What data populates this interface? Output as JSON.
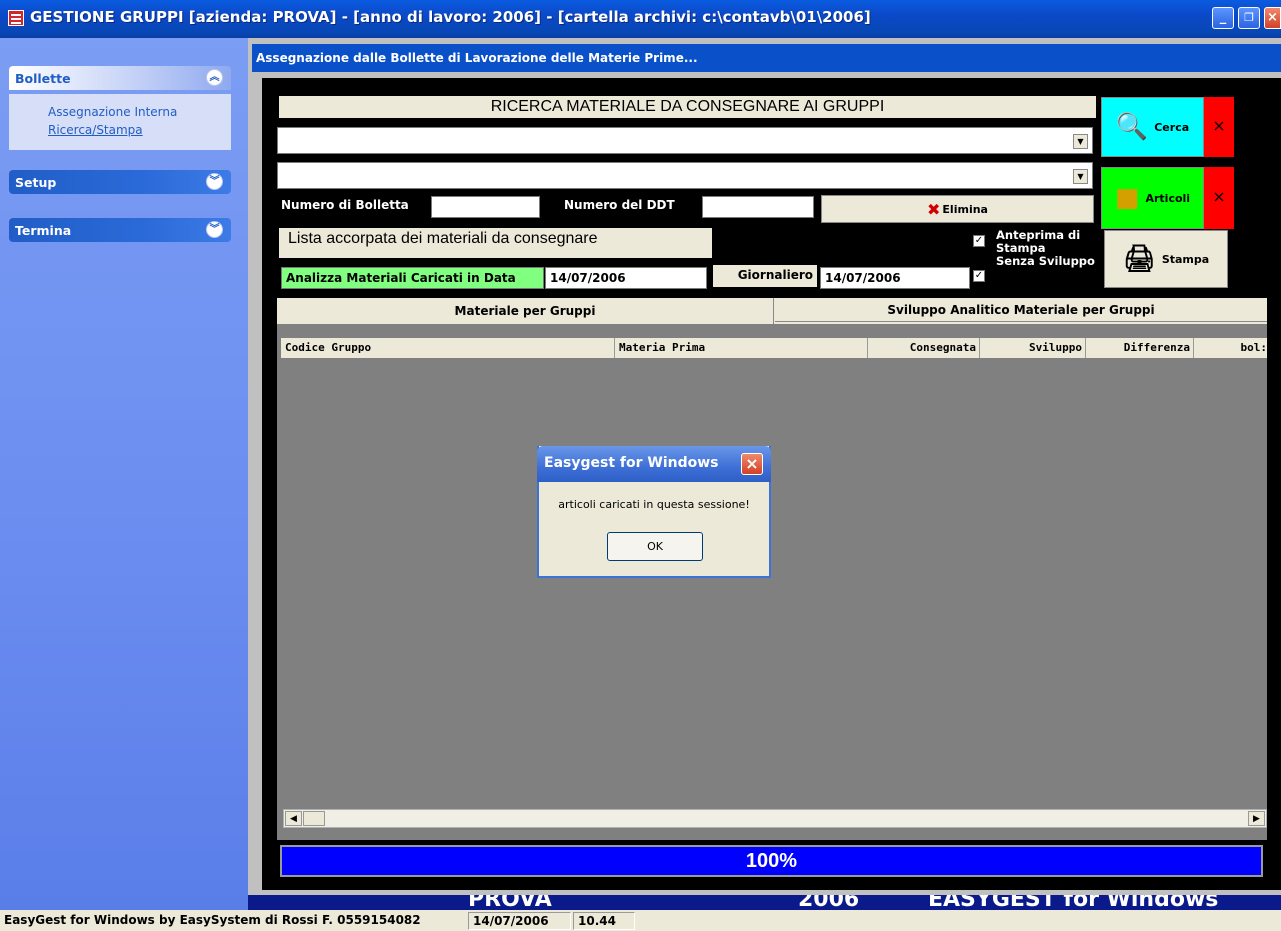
{
  "window": {
    "title": "GESTIONE GRUPPI [azienda: PROVA] - [anno di lavoro: 2006] - [cartella archivi: c:\\contavb\\01\\2006]",
    "controls": [
      "minimize",
      "restore",
      "close"
    ]
  },
  "sidebar": {
    "groups": [
      {
        "label": "Bollette",
        "expanded": true,
        "items": [
          "Assegnazione Interna",
          "Ricerca/Stampa"
        ]
      },
      {
        "label": "Setup",
        "expanded": false,
        "items": []
      },
      {
        "label": "Termina",
        "expanded": false,
        "items": []
      }
    ]
  },
  "form": {
    "subtitle": "Assegnazione dalle Bollette di Lavorazione delle Materie Prime...",
    "search_header": "RICERCA MATERIALE DA CONSEGNARE AI GRUPPI",
    "combo1_value": "",
    "combo2_value": "",
    "bolletta_label": "Numero di Bolletta",
    "bolletta_value": "",
    "ddt_label": "Numero del DDT",
    "ddt_value": "",
    "elimina_label": "Elimina",
    "cerca_label": "Cerca",
    "articoli_label": "Articoli",
    "stampa_label": "Stampa",
    "clear_mark": "×",
    "list_title": "Lista accorpata dei materiali da consegnare",
    "analizza_label": "Analizza Materiali Caricati in Data",
    "analizza_date": "14/07/2006",
    "giornaliero_label": "Giornaliero",
    "giornaliero_date": "14/07/2006",
    "anteprima_label_1": "Anteprima di",
    "anteprima_label_2": "Stampa",
    "anteprima_checked": true,
    "senza_sviluppo_label": "Senza Sviluppo",
    "senza_sviluppo_checked": true
  },
  "tabs": [
    "Materiale per Gruppi",
    "Sviluppo Analitico Materiale per Gruppi"
  ],
  "grid": {
    "columns": [
      "Codice Gruppo",
      "Materia Prima",
      "Consegnata",
      "Sviluppo",
      "Differenza",
      "bol:"
    ],
    "rows": []
  },
  "progress": {
    "label": "100%",
    "value": 1.0
  },
  "background_strip": [
    "PROVA",
    "2006",
    "EASYGEST for Windows"
  ],
  "dialog": {
    "title": "Easygest for Windows",
    "message": "articoli caricati in questa sessione!",
    "ok_label": "OK"
  },
  "statusbar": {
    "company": "EasyGest for Windows by EasySystem di Rossi F.  0559154082",
    "date": "14/07/2006",
    "time": "10.44"
  },
  "colors": {
    "title_bar": "#0a50c8",
    "sidebar": "#6a8cf0",
    "cerca_bg": "#00ffff",
    "articoli_bg": "#00ff00",
    "clear_bg": "#ff0000",
    "analizza_bg": "#80ff80",
    "progress_bar": "#0000ff",
    "grid_bg": "#808080"
  }
}
